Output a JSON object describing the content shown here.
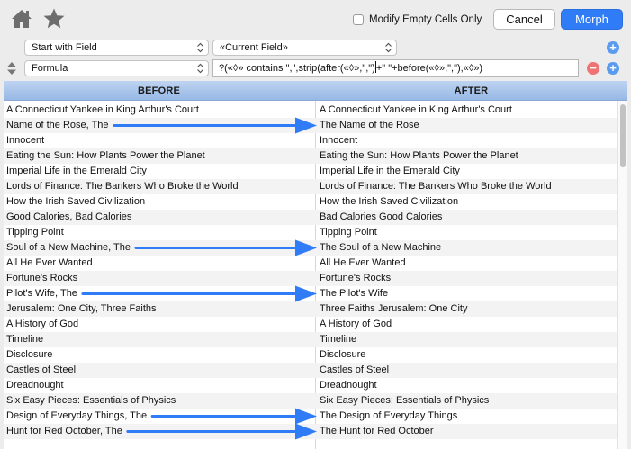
{
  "toolbar": {
    "home_icon": "home-icon",
    "star_icon": "star-icon",
    "modify_label": "Modify Empty Cells Only",
    "modify_checked": false,
    "cancel_label": "Cancel",
    "morph_label": "Morph"
  },
  "rule1": {
    "action": "Start with Field",
    "field": "«Current Field»"
  },
  "rule2": {
    "action": "Formula",
    "formula_before_caret": "?(«◊» contains \",\",strip(after(«◊»,\",\")",
    "formula_after_caret": "+\" \"+before(«◊»,\",\"),«◊»)"
  },
  "colors": {
    "accent": "#2f7cf6",
    "header": "#a9c4ec",
    "arrow": "#2f7cf6",
    "plus": "#5a9bf0",
    "minus": "#f07373"
  },
  "table": {
    "before_header": "BEFORE",
    "after_header": "AFTER",
    "rows": [
      {
        "before": "A Connecticut Yankee in King Arthur's Court",
        "after": "A Connecticut Yankee in King Arthur's Court"
      },
      {
        "before": "Name of the Rose, The",
        "after": "The Name of the Rose"
      },
      {
        "before": "Innocent",
        "after": "Innocent"
      },
      {
        "before": "Eating the Sun: How Plants Power the Planet",
        "after": "Eating the Sun: How Plants Power the Planet"
      },
      {
        "before": "Imperial Life in the Emerald City",
        "after": "Imperial Life in the Emerald City"
      },
      {
        "before": "Lords of Finance: The Bankers Who Broke the World",
        "after": "Lords of Finance: The Bankers Who Broke the World"
      },
      {
        "before": "How the Irish Saved Civilization",
        "after": "How the Irish Saved Civilization"
      },
      {
        "before": "Good Calories, Bad Calories",
        "after": "Bad Calories Good Calories"
      },
      {
        "before": "Tipping Point",
        "after": "Tipping Point"
      },
      {
        "before": "Soul of a New Machine, The",
        "after": "The Soul of a New Machine"
      },
      {
        "before": "All He Ever Wanted",
        "after": "All He Ever Wanted"
      },
      {
        "before": "Fortune's Rocks",
        "after": "Fortune's Rocks"
      },
      {
        "before": "Pilot's Wife, The",
        "after": "The Pilot's Wife"
      },
      {
        "before": "Jerusalem: One City, Three Faiths",
        "after": "Three Faiths Jerusalem: One City"
      },
      {
        "before": "A History of God",
        "after": "A History of God"
      },
      {
        "before": "Timeline",
        "after": "Timeline"
      },
      {
        "before": "Disclosure",
        "after": "Disclosure"
      },
      {
        "before": "Castles of Steel",
        "after": "Castles of Steel"
      },
      {
        "before": "Dreadnought",
        "after": "Dreadnought"
      },
      {
        "before": "Six Easy Pieces: Essentials of Physics",
        "after": "Six Easy Pieces: Essentials of Physics"
      },
      {
        "before": "Design of Everyday Things, The",
        "after": "The Design of Everyday Things"
      },
      {
        "before": "Hunt for Red October, The",
        "after": "The Hunt for Red October"
      }
    ]
  }
}
